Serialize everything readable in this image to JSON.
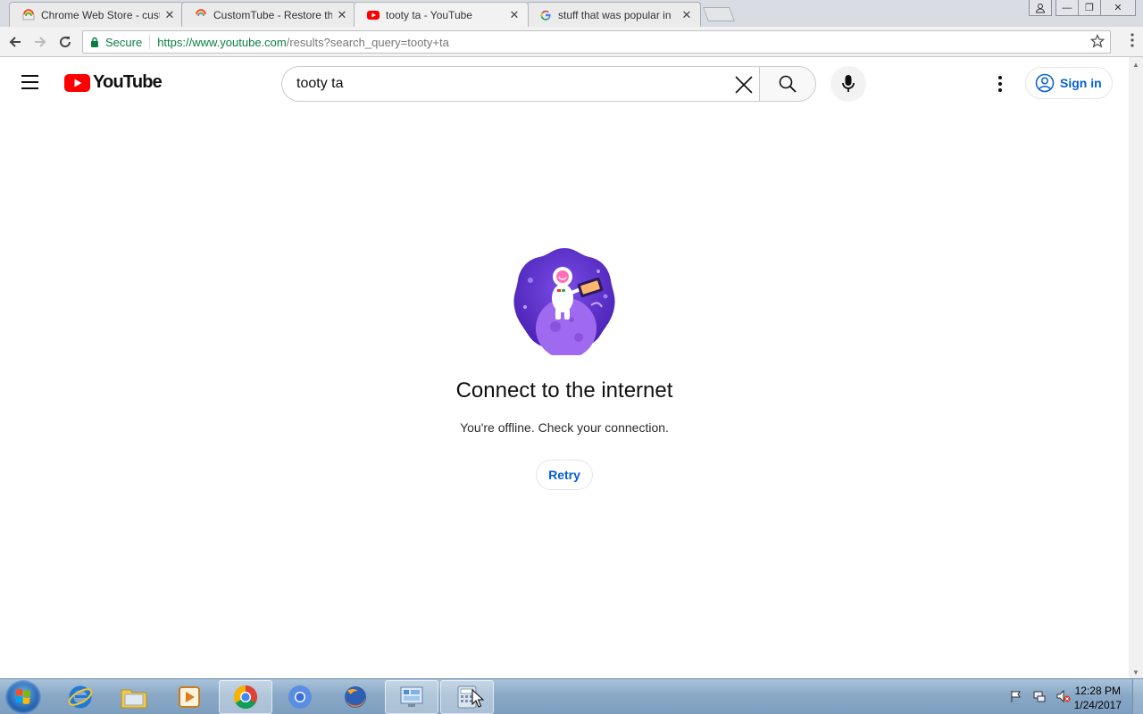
{
  "browser": {
    "tabs": [
      {
        "title": "Chrome Web Store - custo",
        "active": false
      },
      {
        "title": "CustomTube - Restore the",
        "active": false
      },
      {
        "title": "tooty ta - YouTube",
        "active": true
      },
      {
        "title": "stuff that was popular in",
        "active": false
      }
    ],
    "secure_label": "Secure",
    "url_scheme": "https://",
    "url_host": "www.youtube.com",
    "url_rest": "/results?search_query=tooty+ta"
  },
  "youtube": {
    "logo_text": "YouTube",
    "search_value": "tooty ta",
    "signin_label": "Sign in"
  },
  "offline": {
    "title": "Connect to the internet",
    "message": "You're offline. Check your connection.",
    "retry_label": "Retry"
  },
  "taskbar": {
    "time": "12:28 PM",
    "date": "1/24/2017"
  },
  "colors": {
    "yt_red": "#ff0000",
    "link_blue": "#065fd4",
    "secure_green": "#0b8043",
    "illustration_purple": "#6c3fd6"
  }
}
